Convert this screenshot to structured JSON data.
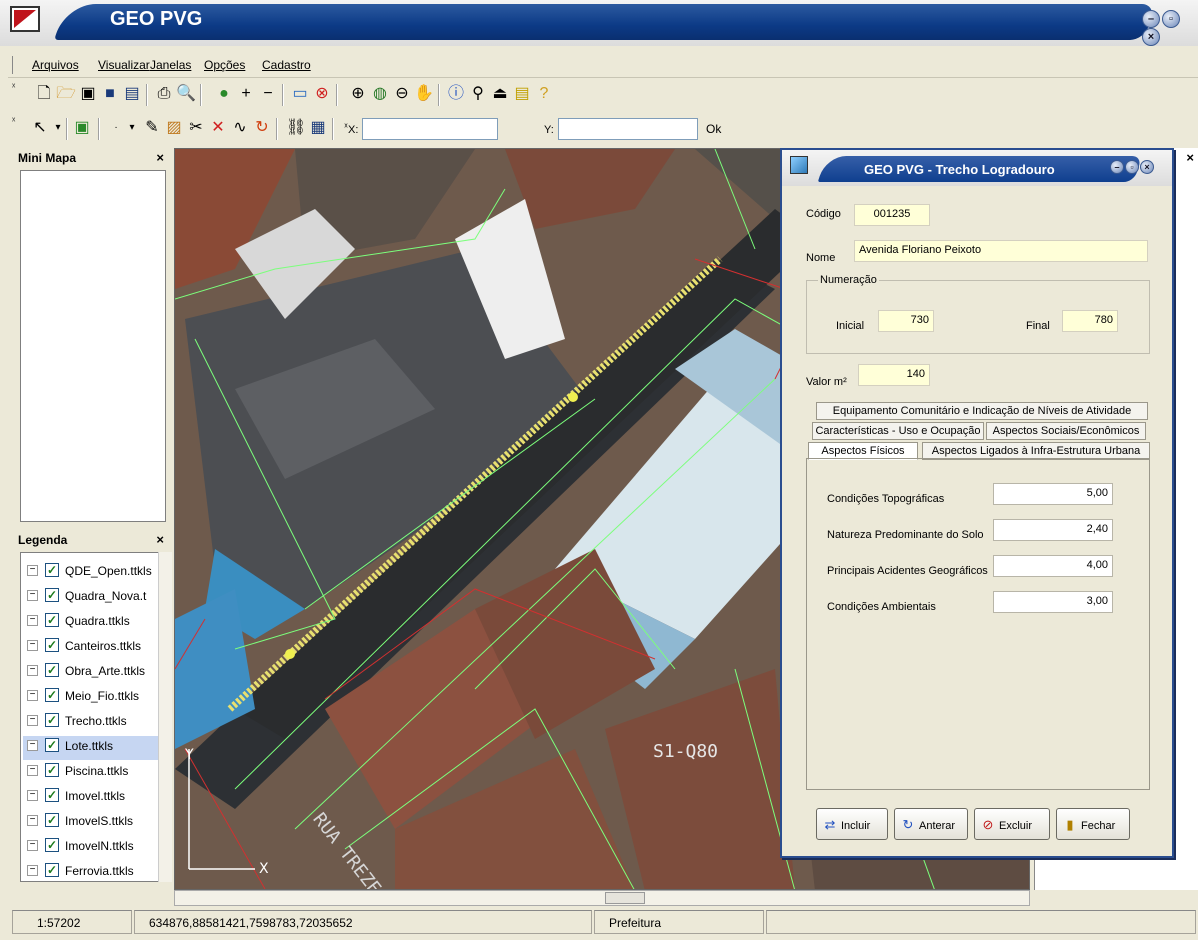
{
  "app": {
    "title": "GEO PVG"
  },
  "menu": [
    {
      "label": "Arquivos"
    },
    {
      "label": "Visualizar"
    },
    {
      "label": "Janelas"
    },
    {
      "label": "Opções"
    },
    {
      "label": "Cadastro"
    }
  ],
  "toolbar2": {
    "x_label": "X:",
    "y_label": "Y:",
    "x_value": "",
    "y_value": "",
    "ok_label": "Ok"
  },
  "minimap": {
    "title": "Mini Mapa"
  },
  "legend": {
    "title": "Legenda",
    "items": [
      {
        "label": "QDE_Open.ttkls",
        "checked": true
      },
      {
        "label": "Quadra_Nova.t",
        "checked": true
      },
      {
        "label": "Quadra.ttkls",
        "checked": true
      },
      {
        "label": "Canteiros.ttkls",
        "checked": true
      },
      {
        "label": "Obra_Arte.ttkls",
        "checked": true
      },
      {
        "label": "Meio_Fio.ttkls",
        "checked": true
      },
      {
        "label": "Trecho.ttkls",
        "checked": true
      },
      {
        "label": "Lote.ttkls",
        "checked": true,
        "selected": true
      },
      {
        "label": "Piscina.ttkls",
        "checked": true
      },
      {
        "label": "Imovel.ttkls",
        "checked": true
      },
      {
        "label": "ImovelS.ttkls",
        "checked": true
      },
      {
        "label": "ImovelN.ttkls",
        "checked": true
      },
      {
        "label": "Ferrovia.ttkls",
        "checked": true
      }
    ]
  },
  "map": {
    "label_block": "S1-Q80",
    "label_street": "RUA TREZE",
    "axis_y": "Y",
    "axis_x": "X"
  },
  "status": {
    "scale": "1:57202",
    "coords": "634876,88581421,7598783,72035652",
    "workspace": "Prefeitura"
  },
  "dialog": {
    "title": "GEO PVG - Trecho Logradouro",
    "codigo_label": "Código",
    "codigo_value": "001235",
    "nome_label": "Nome",
    "nome_value": "Avenida Floriano Peixoto",
    "numeracao_label": "Numeração",
    "inicial_label": "Inicial",
    "inicial_value": "730",
    "final_label": "Final",
    "final_value": "780",
    "valor_label": "Valor m²",
    "valor_value": "140",
    "tabs": [
      {
        "label": "Equipamento Comunitário e Indicação de Níveis de Atividade"
      },
      {
        "label": "Características - Uso e Ocupação"
      },
      {
        "label": "Aspectos Sociais/Econômicos"
      },
      {
        "label": "Aspectos Físicos",
        "active": true
      },
      {
        "label": "Aspectos Ligados à Infra-Estrutura Urbana"
      }
    ],
    "fields": [
      {
        "label": "Condições Topográficas",
        "value": "5,00"
      },
      {
        "label": "Natureza Predominante do Solo",
        "value": "2,40"
      },
      {
        "label": "Principais Acidentes Geográficos",
        "value": "4,00"
      },
      {
        "label": "Condições Ambientais",
        "value": "3,00"
      }
    ],
    "buttons": [
      {
        "label": "Incluir",
        "icon": "add-icon"
      },
      {
        "label": "Anterar",
        "icon": "edit-icon"
      },
      {
        "label": "Excluir",
        "icon": "delete-icon"
      },
      {
        "label": "Fechar",
        "icon": "exit-icon"
      }
    ]
  }
}
